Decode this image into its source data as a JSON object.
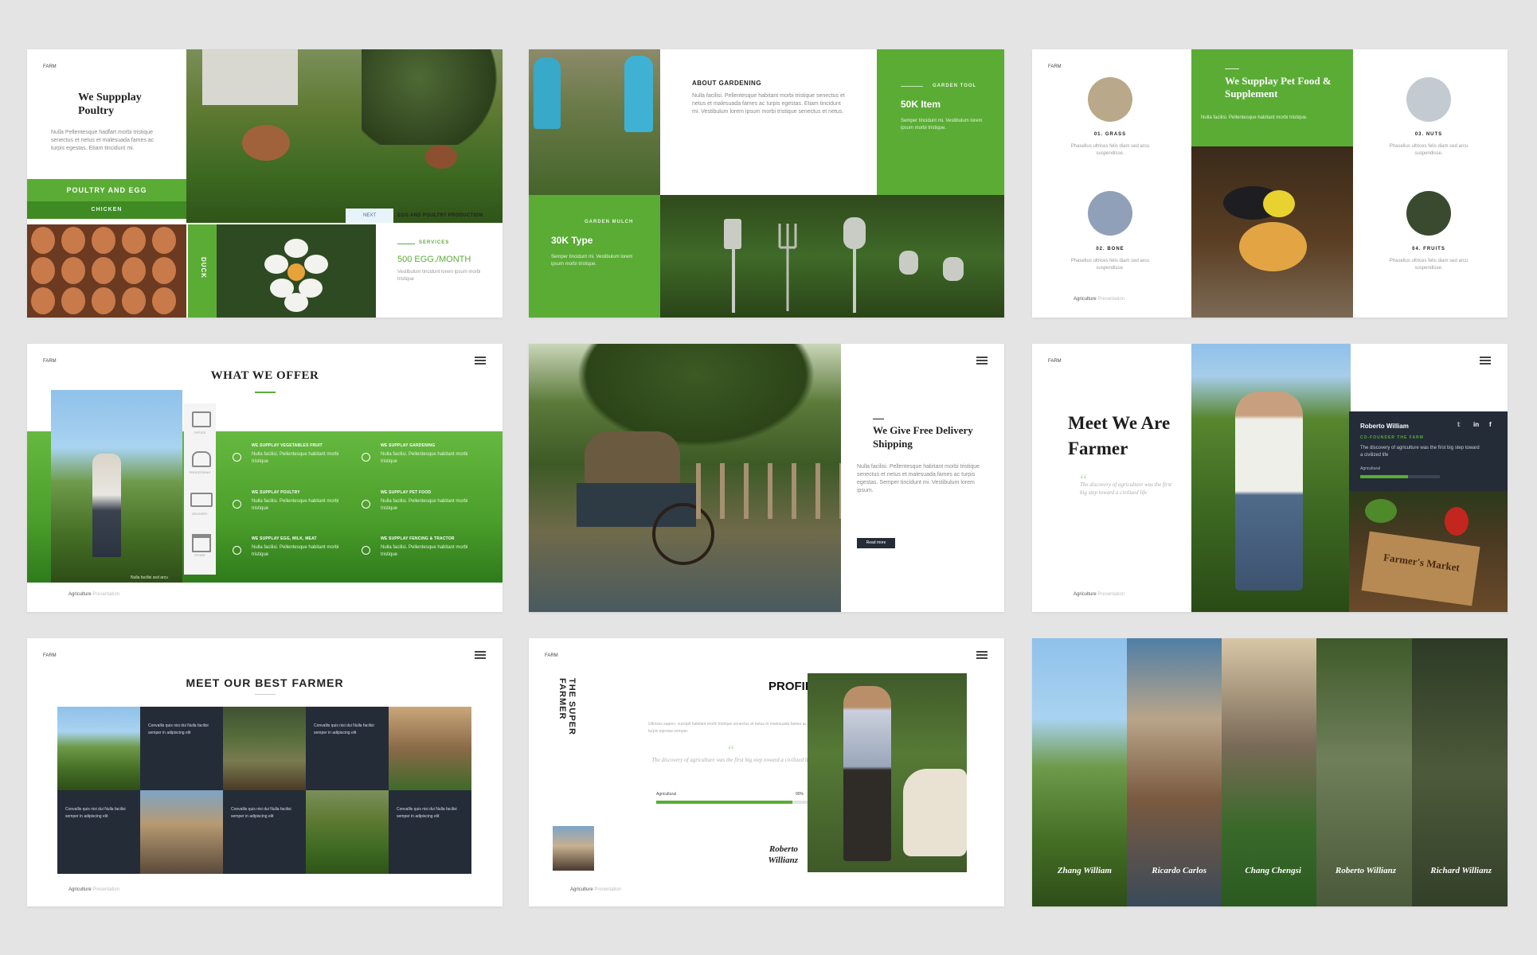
{
  "brand_tag": "FARM",
  "footer": {
    "brand": "Agriculture",
    "sub": "Presentation"
  },
  "s1": {
    "title": "We Suppplay Poultry",
    "body": "Nulla Pellentesque hadfart morbi tristique senectus et netus et malesuada fames ac turpis egestas. Etiam tincidunt mi.",
    "band": "POULTRY AND EGG",
    "sub_band": "CHICKEN",
    "side_label": "DUCK",
    "next": "NEXT",
    "heading": "EGG AND POULTRY PRODUCTION",
    "services": "SERVICES",
    "stat": "500 EGG./MONTH",
    "stat_body": "Vestibulum tincidunt lorem ipsum morbi tristique"
  },
  "s2": {
    "about_title": "ABOUT GARDENING",
    "about_body": "Nulla facilisi. Pellentesque habitant morbi tristique senectus et netus et malesuada fames ac turpis egestas. Etiam tincidunt mi. Vestibulum lorem ipsum morbi tristique senectus et netus.",
    "tool_label": "GARDEN TOOL",
    "tool_stat": "50K Item",
    "tool_body": "Semper tincidunt mi. Vestibulum lorem ipsum morbi tristique.",
    "mulch_label": "GARDEN MULCH",
    "mulch_stat": "30K Type",
    "mulch_body": "Semper tincidunt mi. Vestibulum lorem ipsum morbi tristique."
  },
  "s3": {
    "title": "We Supplay Pet Food & Supplement",
    "body": "Nulla facilisi. Pellentesque habitant morbi tristique.",
    "items": [
      {
        "label": "01. GRASS",
        "body": "Phasellus ultrices felis diam sed arcu suspendisse."
      },
      {
        "label": "02. BONE",
        "body": "Phasellus ultrices felis diam sed arcu suspendisse."
      },
      {
        "label": "03. NUTS",
        "body": "Phasellus ultrices felis diam sed arcu suspendisse."
      },
      {
        "label": "04. FRUITS",
        "body": "Phasellus ultrices felis diam sed arcu suspendisse."
      }
    ]
  },
  "s4": {
    "title": "WHAT WE OFFER",
    "caption": "Nulla facilisi sed arcu",
    "icons": [
      "OFFICE",
      "PROCESSING",
      "DELIVERY",
      "STORE"
    ],
    "offers": [
      {
        "title": "WE SUPPLAY VEGETABLES FRUIT",
        "body": "Nulla facilisi. Pellentesque habitant morbi tristique"
      },
      {
        "title": "WE SUPPLAY GARDENING",
        "body": "Nulla facilisi. Pellentesque habitant morbi tristique"
      },
      {
        "title": "WE SUPPLAY POULTRY",
        "body": "Nulla facilisi. Pellentesque habitant morbi tristique"
      },
      {
        "title": "WE SUPPLAY PET FOOD",
        "body": "Nulla facilisi. Pellentesque habitant morbi tristique"
      },
      {
        "title": "WE SUPPLAY EGG, MILK, MEAT",
        "body": "Nulla facilisi. Pellentesque habitant morbi tristique"
      },
      {
        "title": "WE SUPPLAY FENCING & TRACTOR",
        "body": "Nulla facilisi. Pellentesque habitant morbi tristique"
      }
    ]
  },
  "s5": {
    "title": "We Give Free Delivery Shipping",
    "body": "Nulla facilisi. Pellentesque habitant morbi tristique senectus et netus et malesuada fames ac turpis egestas. Semper tincidunt mi. Vestibulum lorem ipsum.",
    "button": "Read more"
  },
  "s6": {
    "title": "Meet We Are Farmer",
    "quote": "The discovery of agriculture was the first big step toward a civilized life",
    "name": "Roberto William",
    "role": "CO-FOUNDER THE FARM",
    "desc": "The discovery of agriculture was the first big step toward a civilized life",
    "skill": "Agricultural",
    "skill_level": 0.6,
    "crate": "Farmer's Market"
  },
  "s7": {
    "title": "MEET OUR BEST FARMER",
    "cell_text": "Convallis quis nisi dui Nulla facilisi semper in adipiscing elit"
  },
  "s8": {
    "vertical": "THE SUPER FARMER",
    "title": "PROFILE",
    "body": "Ultricies sapien, suscipit habitant morbi tristique senectus et netus et malesuada fames ac turpis egestas semper.",
    "quote": "The discovery of agriculture was the first big step toward a civilized life",
    "skill": "Agricultural",
    "skill_pct": "90%",
    "skill_level": 0.9,
    "name": "Roberto Willianz"
  },
  "s9": {
    "names": [
      "Zhang William",
      "Ricardo Carlos",
      "Chang Chengsi",
      "Roberto Willianz",
      "Richard Willianz"
    ]
  },
  "colors": {
    "accent": "#5aac35",
    "dark": "#242c38",
    "background": "#e4e4e4"
  }
}
